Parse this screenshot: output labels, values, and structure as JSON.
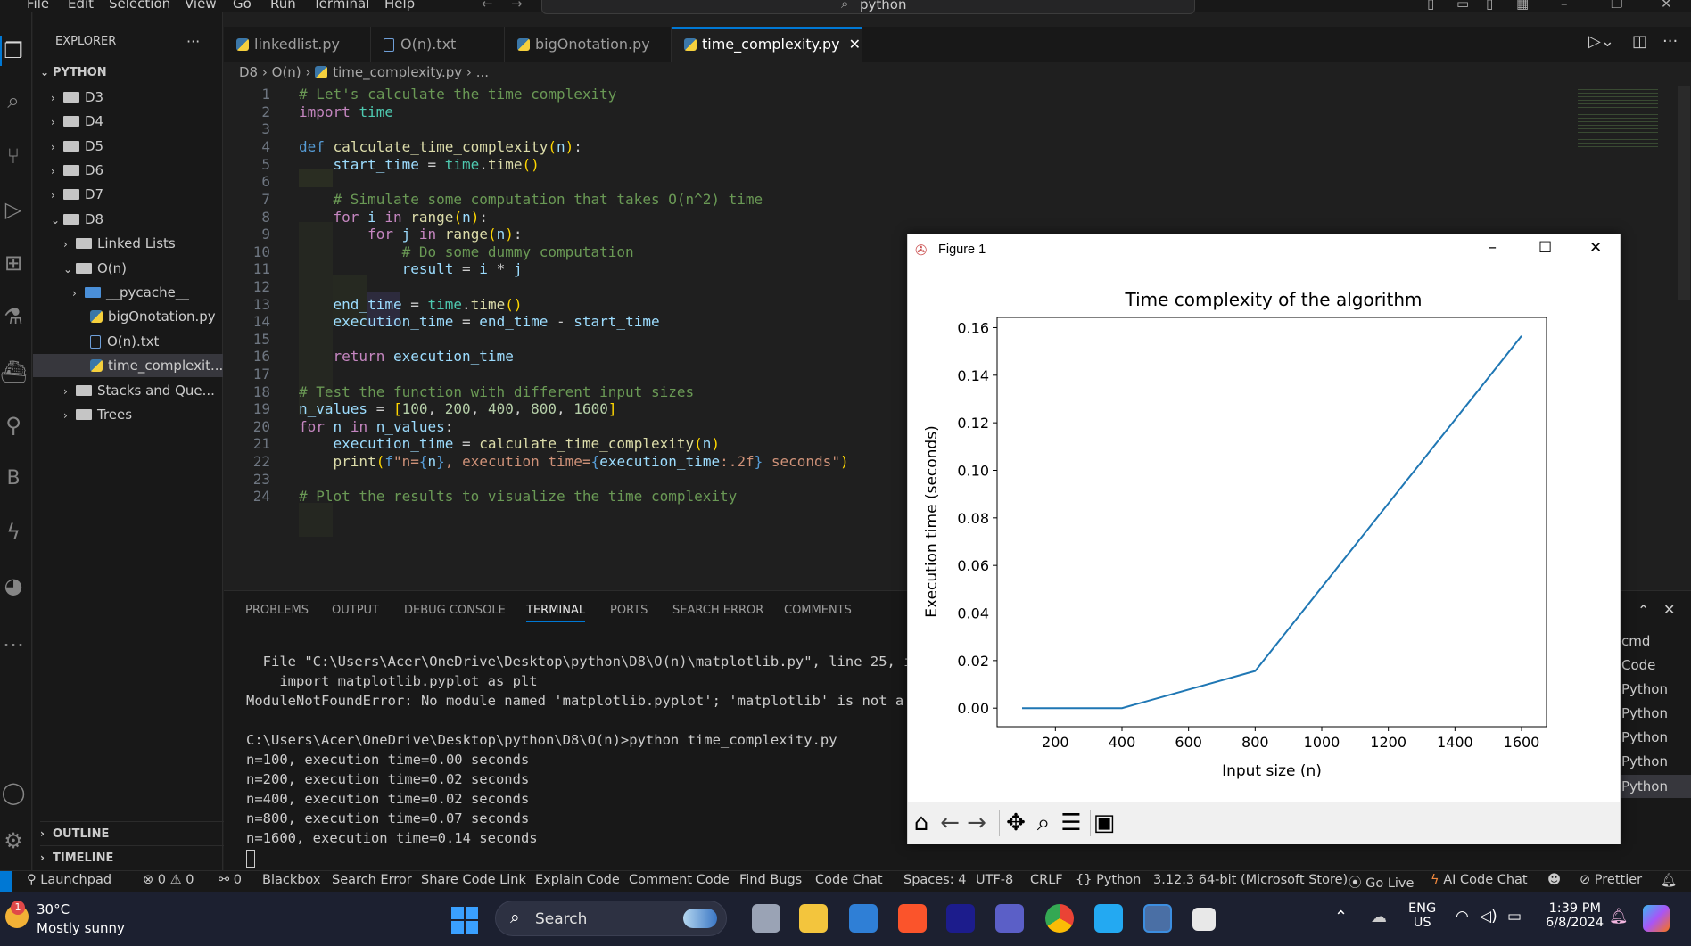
{
  "menubar": {
    "items": [
      "File",
      "Edit",
      "Selection",
      "View",
      "Go",
      "Run",
      "Terminal",
      "Help"
    ],
    "search_text": "python"
  },
  "explorer": {
    "title": "EXPLORER",
    "section": "PYTHON",
    "items": [
      "D3",
      "D4",
      "D5",
      "D6",
      "D7",
      "D8",
      "Linked Lists",
      "O(n)",
      "__pycache__",
      "bigOnotation.py",
      "O(n).txt",
      "time_complexit...",
      "Stacks and Que...",
      "Trees"
    ],
    "outline": "OUTLINE",
    "timeline": "TIMELINE"
  },
  "tabs": [
    "linkedlist.py",
    "O(n).txt",
    "bigOnotation.py",
    "time_complexity.py"
  ],
  "breadcrumb": {
    "p1": "D8",
    "p2": "O(n)",
    "p3": "time_complexity.py",
    "p4": "..."
  },
  "editor": {
    "line_numbers": [
      "1",
      "2",
      "3",
      "4",
      "5",
      "6",
      "7",
      "8",
      "9",
      "10",
      "11",
      "12",
      "13",
      "14",
      "15",
      "16",
      "17",
      "18",
      "19",
      "20",
      "21",
      "22",
      "23",
      "24"
    ]
  },
  "panel": {
    "tabs": [
      "PROBLEMS",
      "OUTPUT",
      "DEBUG CONSOLE",
      "TERMINAL",
      "PORTS",
      "SEARCH ERROR",
      "COMMENTS"
    ],
    "terminal_lines": [
      "  File \"C:\\Users\\Acer\\OneDrive\\Desktop\\python\\D8\\O(n)\\matplotlib.py\", line 25, in <",
      "    import matplotlib.pyplot as plt",
      "ModuleNotFoundError: No module named 'matplotlib.pyplot'; 'matplotlib' is not a pac",
      "",
      "C:\\Users\\Acer\\OneDrive\\Desktop\\python\\D8\\O(n)>python time_complexity.py",
      "n=100, execution time=0.00 seconds",
      "n=200, execution time=0.02 seconds",
      "n=400, execution time=0.02 seconds",
      "n=800, execution time=0.07 seconds",
      "n=1600, execution time=0.14 seconds"
    ],
    "terminal_list": [
      "cmd",
      "Code",
      "Python",
      "Python",
      "Python",
      "Python",
      "Python"
    ]
  },
  "statusbar": {
    "launchpad": "Launchpad",
    "errors": "0",
    "warnings": "0",
    "ports": "0",
    "items": [
      "Blackbox",
      "Search Error",
      "Share Code Link",
      "Explain Code",
      "Comment Code",
      "Find Bugs",
      "Code Chat"
    ],
    "spaces": "Spaces: 4",
    "encoding": "UTF-8",
    "eol": "CRLF",
    "language": "Python",
    "interpreter": "3.12.3 64-bit (Microsoft Store)",
    "golive": "Go Live",
    "aichat": "AI Code Chat",
    "prettier": "Prettier"
  },
  "taskbar": {
    "weather_temp": "30°C",
    "weather_desc": "Mostly sunny",
    "search": "Search",
    "lang1": "ENG",
    "lang2": "US",
    "time": "1:39 PM",
    "date": "6/8/2024",
    "badge": "1"
  },
  "figure": {
    "window_title": "Figure 1"
  },
  "chart_data": {
    "type": "line",
    "title": "Time complexity of the algorithm",
    "xlabel": "Input size (n)",
    "ylabel": "Execution time (seconds)",
    "x": [
      100,
      200,
      400,
      800,
      1600
    ],
    "y": [
      0.0,
      0.0,
      0.0,
      0.0156,
      0.1565
    ],
    "xlim": [
      25,
      1675
    ],
    "ylim": [
      -0.0078,
      0.1643
    ],
    "xticks": [
      200,
      400,
      600,
      800,
      1000,
      1200,
      1400,
      1600
    ],
    "xtick_labels": [
      "200",
      "400",
      "600",
      "800",
      "1000",
      "1200",
      "1400",
      "1600"
    ],
    "yticks": [
      0.0,
      0.02,
      0.04,
      0.06,
      0.08,
      0.1,
      0.12,
      0.14,
      0.16
    ],
    "ytick_labels": [
      "0.00",
      "0.02",
      "0.04",
      "0.06",
      "0.08",
      "0.10",
      "0.12",
      "0.14",
      "0.16"
    ],
    "line_color": "#1f77b4",
    "grid": false
  }
}
